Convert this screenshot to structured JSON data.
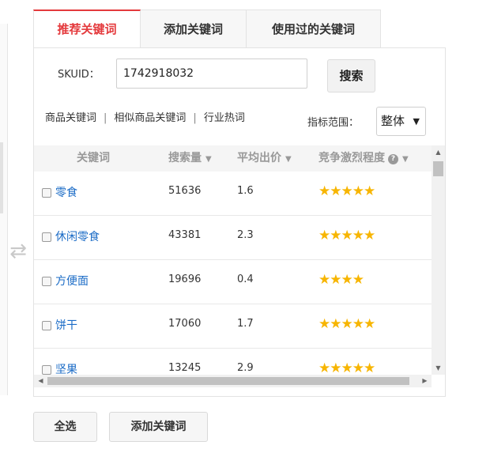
{
  "tabs": [
    "推荐关键词",
    "添加关键词",
    "使用过的关键词"
  ],
  "search": {
    "label": "SKUID：",
    "value": "1742918032",
    "button": "搜索"
  },
  "keyword_links": [
    "商品关键词",
    "相似商品关键词",
    "行业热词"
  ],
  "keyword_link_separator": "|",
  "range": {
    "label": "指标范围：",
    "value": "整体",
    "caret": "▼"
  },
  "table": {
    "headers": {
      "keyword": "关键词",
      "volume": "搜索量",
      "bid": "平均出价",
      "competition": "竞争激烈程度",
      "sort_arrow": "▼",
      "help": "?"
    },
    "rows": [
      {
        "keyword": "零食",
        "volume": "51636",
        "bid": "1.6",
        "stars": 5
      },
      {
        "keyword": "休闲零食",
        "volume": "43381",
        "bid": "2.3",
        "stars": 5
      },
      {
        "keyword": "方便面",
        "volume": "19696",
        "bid": "0.4",
        "stars": 4
      },
      {
        "keyword": "饼干",
        "volume": "17060",
        "bid": "1.7",
        "stars": 5
      },
      {
        "keyword": "坚果",
        "volume": "13245",
        "bid": "2.9",
        "stars": 5
      }
    ]
  },
  "scroll_arrows": {
    "up": "▲",
    "down": "▼",
    "left": "◀",
    "right": "▶"
  },
  "swap_icon_glyph": "⇄",
  "buttons": {
    "select_all": "全选",
    "add_keywords": "添加关键词"
  },
  "colors": {
    "accent": "#e4393c",
    "link": "#1a6bc6",
    "star": "#f7b500"
  }
}
